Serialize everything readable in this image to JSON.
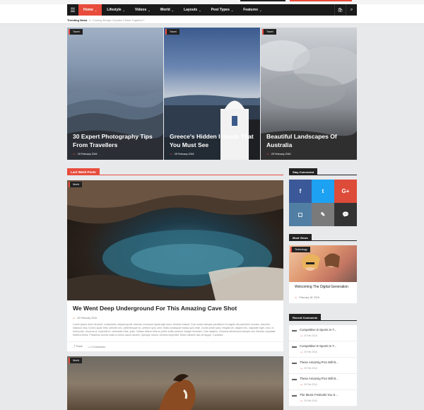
{
  "nav": {
    "items": [
      {
        "label": "Home",
        "active": true,
        "caret": "⌄"
      },
      {
        "label": "Lifestyle",
        "active": false,
        "caret": "⌄"
      },
      {
        "label": "Videos",
        "active": false,
        "caret": "⌄"
      },
      {
        "label": "World",
        "active": false,
        "caret": "⌄"
      },
      {
        "label": "Layouts",
        "active": false,
        "caret": "⌄"
      },
      {
        "label": "Post Types",
        "active": false,
        "caret": "⌄"
      },
      {
        "label": "Features",
        "active": false,
        "caret": "⌄"
      }
    ],
    "icons": {
      "menu": "☰",
      "cart": "🛍",
      "search": "⌕"
    }
  },
  "trending": {
    "label": "Trending News",
    "arrow": "›",
    "text": "Coming Brings Couples Closer Together?"
  },
  "hero": [
    {
      "tag": "Travel",
      "title": "30 Expert Photography Tips From Travellers",
      "date": "18 February 2016"
    },
    {
      "tag": "Travel",
      "title": "Greece's Hidden Islands That You Must See",
      "date": "25 February 2016"
    },
    {
      "tag": "Travel",
      "title": "Beautiful Landscapes Of Australia",
      "date": "25 February 2016"
    }
  ],
  "main": {
    "section_title": "Last Week Posts",
    "post": {
      "tag": "World",
      "title": "We Went Deep Underground For This Amazing Cave Shot",
      "date": "25 February 2016",
      "excerpt": "Lorem ipsum dolor sit amet, consectetur adipiscing elit. Aenean commodo ligula eget dolor. Aenean massa. Cum sociis natoque penatibus et magnis dis parturient montes, nascetur ridiculus mus. Donec quam felis, ultricies nec, pellentesque eu, pretium quis, sem. Nulla consequat massa quis enim. Donec pede justo, fringilla vel, aliquet nec, vulputate eget, arcu. In enim justo, rhoncus ut, imperdiet a, venenatis vitae, justo. Nullam dictum felis eu pede mollis pretium. Integer tincidunt. Cras dapibus. Vivamus elementum semper nisi. Aenean vulputate eleifend tellus. Phasellus viverra nulla ut metus varius laoreet. Quisque rutrum. Aenean imperdiet. Etiam ultricies nisi vel augue. Curabitur...",
      "share": "Share",
      "comments": "0 Comments"
    },
    "post2": {
      "tag": "World"
    }
  },
  "sidebar": {
    "stay_connected": "Stay Connected",
    "social": [
      {
        "name": "facebook",
        "glyph": "f",
        "color": "#3b5998"
      },
      {
        "name": "twitter",
        "glyph": "t",
        "color": "#1da1f2"
      },
      {
        "name": "google-plus",
        "glyph": "G+",
        "color": "#dd4b39"
      },
      {
        "name": "instagram",
        "glyph": "◻",
        "color": "#517fa4"
      },
      {
        "name": "edit",
        "glyph": "✎",
        "color": "#7a7a7a"
      },
      {
        "name": "chat",
        "glyph": "💬",
        "color": "#333333"
      }
    ],
    "most_views": {
      "title": "Most Views",
      "tag": "Technology",
      "post_title": "Welcoming The Digital Generation",
      "date": "February 18, 2016"
    },
    "recent_comments": {
      "title": "Recent Comments",
      "items": [
        {
          "title": "Competitive E-Sports In T...",
          "date": "25 Feb 2016"
        },
        {
          "title": "Competitive E-Sports In T...",
          "date": "25 Feb 2016"
        },
        {
          "title": "These Amazing Pics Will B...",
          "date": "25 Feb 2016"
        },
        {
          "title": "These Amazing Pics Will B...",
          "date": "25 Feb 2016"
        },
        {
          "title": "The Music Festivals You S...",
          "date": "25 Feb 2016"
        }
      ]
    }
  }
}
